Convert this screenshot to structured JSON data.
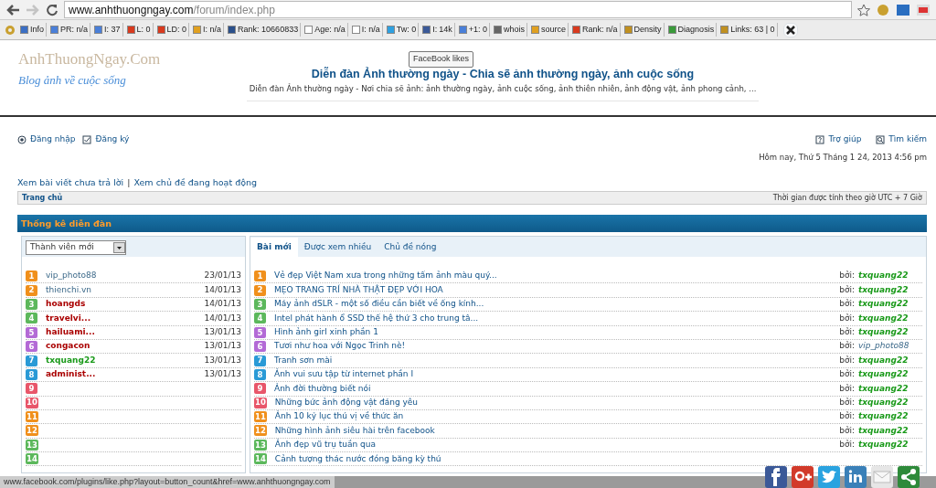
{
  "browser": {
    "url_domain": "www.anhthuongngay.com",
    "url_path": "/forum/index.php",
    "forward_disabled": true
  },
  "toolbar": [
    {
      "label": "Info",
      "color": "#3b6fc4"
    },
    {
      "label": "PR: n/a",
      "color": "#4a7fd8"
    },
    {
      "label": "I: 37",
      "color": "#4a7fd8"
    },
    {
      "label": "L: 0",
      "color": "#d83a1e"
    },
    {
      "label": "LD: 0",
      "color": "#d83a1e"
    },
    {
      "label": "I: n/a",
      "color": "#e0a020"
    },
    {
      "label": "Rank: 10660833",
      "color": "#2a4f8a"
    },
    {
      "label": "Age: n/a",
      "color": "#ffffff"
    },
    {
      "label": "I: n/a",
      "color": "#ffffff"
    },
    {
      "label": "Tw: 0",
      "color": "#2ea0e0"
    },
    {
      "label": "I:",
      "link": "14k",
      "color": "#3b5998"
    },
    {
      "label": "+1: 0",
      "color": "#4a7fd8"
    },
    {
      "label": "whois",
      "color": "#666666"
    },
    {
      "label": "source",
      "color": "#e0a020"
    },
    {
      "label": "Rank: n/a",
      "color": "#d83a1e"
    },
    {
      "label": "Density",
      "color": "#c09020"
    },
    {
      "label": "Diagnosis",
      "color": "#3a9a3a"
    },
    {
      "label": "Links: 63 | 0",
      "color": "#c09020"
    }
  ],
  "tooltip": "FaceBook likes",
  "header": {
    "logo": "AnhThuongNgay.Com",
    "slogan": "Blog ảnh về cuộc sống",
    "title": "Diễn đàn Ảnh thường ngày - Chia sẽ ảnh thường ngày, ảnh cuộc sống",
    "description": "Diễn đàn Ảnh thường ngày - Nơi chia sẽ ảnh: ảnh thường ngày, ảnh cuộc sống, ảnh thiên nhiên, ảnh động vật, ảnh phong cảnh, ..."
  },
  "user_links": [
    "Đăng nhập",
    "Đăng ký"
  ],
  "help_links": [
    "Trợ giúp",
    "Tìm kiếm"
  ],
  "date": "Hôm nay, Thứ 5 Tháng 1 24, 2013 4:56 pm",
  "quick_links": [
    "Xem bài viết chưa trả lời",
    "|",
    "Xem chủ đề đang hoạt động"
  ],
  "breadcrumb": {
    "home": "Trang chủ",
    "timezone": "Thời gian được tính theo giờ UTC + 7 Giờ"
  },
  "section_title": "Thống kê diễn đàn",
  "members_select": "Thành viên mới",
  "members": [
    {
      "rank": "1",
      "color": "#f0901c",
      "name": "vip_photo88",
      "kind": "member",
      "date": "23/01/13"
    },
    {
      "rank": "2",
      "color": "#f0901c",
      "name": "thienchi.vn",
      "kind": "member",
      "date": "14/01/13"
    },
    {
      "rank": "3",
      "color": "#5cb85c",
      "name": "hoangds",
      "kind": "admin",
      "date": "14/01/13"
    },
    {
      "rank": "4",
      "color": "#5cb85c",
      "name": "travelvi...",
      "kind": "admin",
      "date": "14/01/13"
    },
    {
      "rank": "5",
      "color": "#b36ad6",
      "name": "hailuami...",
      "kind": "admin",
      "date": "13/01/13"
    },
    {
      "rank": "6",
      "color": "#b36ad6",
      "name": "congacon",
      "kind": "admin",
      "date": "13/01/13"
    },
    {
      "rank": "7",
      "color": "#2a9ad6",
      "name": "txquang22",
      "kind": "moderator",
      "date": "13/01/13"
    },
    {
      "rank": "8",
      "color": "#2a9ad6",
      "name": "administ...",
      "kind": "admin",
      "date": "13/01/13"
    },
    {
      "rank": "9",
      "color": "#e8566a"
    },
    {
      "rank": "10",
      "color": "#e8566a"
    },
    {
      "rank": "11",
      "color": "#f0901c"
    },
    {
      "rank": "12",
      "color": "#f0901c"
    },
    {
      "rank": "13",
      "color": "#5cb85c"
    },
    {
      "rank": "14",
      "color": "#5cb85c"
    }
  ],
  "tabs": [
    {
      "label": "Bài mới",
      "selected": true
    },
    {
      "label": "Được xem nhiều",
      "selected": false
    },
    {
      "label": "Chủ đề nóng",
      "selected": false
    }
  ],
  "posts": [
    {
      "rank": "1",
      "color": "#f0901c",
      "title": "Vẻ đẹp Việt Nam xưa trong những tấm ảnh màu quý...",
      "by": "bởi:",
      "author": "txquang22",
      "kind": "moderator"
    },
    {
      "rank": "2",
      "color": "#f0901c",
      "title": "MẸO TRANG TRÍ NHÀ THẬT ĐẸP VỚI HOA",
      "by": "bởi:",
      "author": "txquang22",
      "kind": "moderator"
    },
    {
      "rank": "3",
      "color": "#5cb85c",
      "title": "Máy ảnh dSLR - một số điều cần biết về ống kính...",
      "by": "bởi:",
      "author": "txquang22",
      "kind": "moderator"
    },
    {
      "rank": "4",
      "color": "#5cb85c",
      "title": "Intel phát hành ổ SSD thế hệ thứ 3 cho trung tâ...",
      "by": "bởi:",
      "author": "txquang22",
      "kind": "moderator"
    },
    {
      "rank": "5",
      "color": "#b36ad6",
      "title": "Hình ảnh girl xinh phần 1",
      "by": "bởi:",
      "author": "txquang22",
      "kind": "moderator"
    },
    {
      "rank": "6",
      "color": "#b36ad6",
      "title": "Tươi như hoa với Ngọc Trinh nè!",
      "by": "bởi:",
      "author": "vip_photo88",
      "kind": "member"
    },
    {
      "rank": "7",
      "color": "#2a9ad6",
      "title": "Tranh sơn mài",
      "by": "bởi:",
      "author": "txquang22",
      "kind": "moderator"
    },
    {
      "rank": "8",
      "color": "#2a9ad6",
      "title": "Ảnh vui sưu tập từ internet phần I",
      "by": "bởi:",
      "author": "txquang22",
      "kind": "moderator"
    },
    {
      "rank": "9",
      "color": "#e8566a",
      "title": "Ảnh đời thường biết nói",
      "by": "bởi:",
      "author": "txquang22",
      "kind": "moderator"
    },
    {
      "rank": "10",
      "color": "#e8566a",
      "title": "Những bức ảnh động vật đáng yêu",
      "by": "bởi:",
      "author": "txquang22",
      "kind": "moderator"
    },
    {
      "rank": "11",
      "color": "#f0901c",
      "title": "Ảnh 10 kỷ lục thú vị về thức ăn",
      "by": "bởi:",
      "author": "txquang22",
      "kind": "moderator"
    },
    {
      "rank": "12",
      "color": "#f0901c",
      "title": "Những hình ảnh siêu hài trên facebook",
      "by": "bởi:",
      "author": "txquang22",
      "kind": "moderator"
    },
    {
      "rank": "13",
      "color": "#5cb85c",
      "title": "Ảnh đẹp vũ trụ tuần qua",
      "by": "bởi:",
      "author": "txquang22",
      "kind": "moderator"
    },
    {
      "rank": "14",
      "color": "#5cb85c",
      "title": "Cảnh tượng thác nước đóng băng kỳ thú"
    }
  ],
  "status_url": "www.facebook.com/plugins/like.php?layout=button_count&href=www.anhthuongngay.com",
  "share": [
    {
      "kind": "facebook"
    },
    {
      "kind": "googleplus"
    },
    {
      "kind": "twitter"
    },
    {
      "kind": "linkedin"
    },
    {
      "kind": "email"
    },
    {
      "kind": "share"
    }
  ]
}
